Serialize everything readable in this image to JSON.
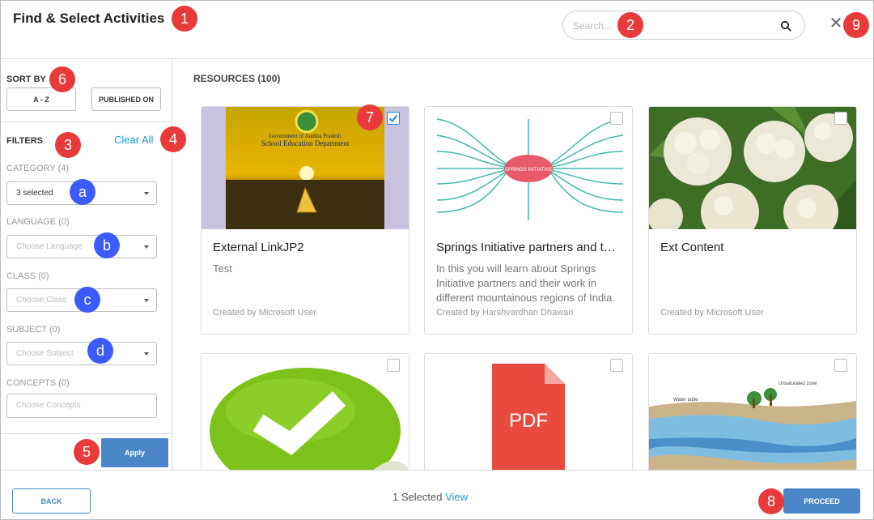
{
  "header": {
    "title": "Find & Select Activities",
    "search_placeholder": "Search..."
  },
  "sidebar": {
    "sort_by_label": "SORT BY",
    "sort_buttons": [
      "A - Z",
      "PUBLISHED ON"
    ],
    "filters_label": "FILTERS",
    "clear_all": "Clear All",
    "filters": [
      {
        "label": "CATEGORY (4)",
        "value": "3 selected",
        "placeholder": ""
      },
      {
        "label": "LANGUAGE (0)",
        "value": "",
        "placeholder": "Choose Language"
      },
      {
        "label": "CLASS (0)",
        "value": "",
        "placeholder": "Choose Class"
      },
      {
        "label": "SUBJECT (0)",
        "value": "",
        "placeholder": "Choose Subject"
      },
      {
        "label": "CONCEPTS (0)",
        "value": "",
        "placeholder": "Choose Concepts"
      }
    ],
    "apply_label": "Apply"
  },
  "main": {
    "resources_title": "RESOURCES (100)",
    "cards": [
      {
        "title": "External LinkJP2",
        "description": "Test",
        "created_by": "Created by Microsoft User",
        "checked": true,
        "thumb_text_1": "Government of Andhra Pradesh",
        "thumb_text_2": "School Education Department"
      },
      {
        "title": "Springs Initiative partners and their work",
        "description": "In this you will learn about Springs Initiative partners and their work in different mountainous regions of India.",
        "created_by": "Created by Harshvardhan Dhawan",
        "checked": false,
        "thumb_text_1": "SPRINGS INITIATIVE"
      },
      {
        "title": "Ext Content",
        "description": "",
        "created_by": "Created by Microsoft User",
        "checked": false
      },
      {
        "title": "",
        "description": "",
        "created_by": "",
        "checked": false
      },
      {
        "title": "",
        "description": "",
        "created_by": "",
        "checked": false,
        "thumb_text_1": "PDF"
      },
      {
        "title": "",
        "description": "",
        "created_by": "",
        "checked": false,
        "thumb_text_1": "Water table",
        "thumb_text_2": "Unsaturated zone"
      }
    ]
  },
  "footer": {
    "back_label": "BACK",
    "selected_count": "1 Selected",
    "view_label": "View",
    "proceed_label": "PROCEED"
  },
  "markers": {
    "red": [
      "1",
      "2",
      "3",
      "4",
      "5",
      "6",
      "7",
      "8",
      "9"
    ],
    "blue": [
      "a",
      "b",
      "c",
      "d"
    ]
  },
  "colors": {
    "accent": "#4a86c8",
    "link": "#1a9ad6",
    "marker_red": "#e83a3a",
    "marker_blue": "#3d5afe"
  }
}
